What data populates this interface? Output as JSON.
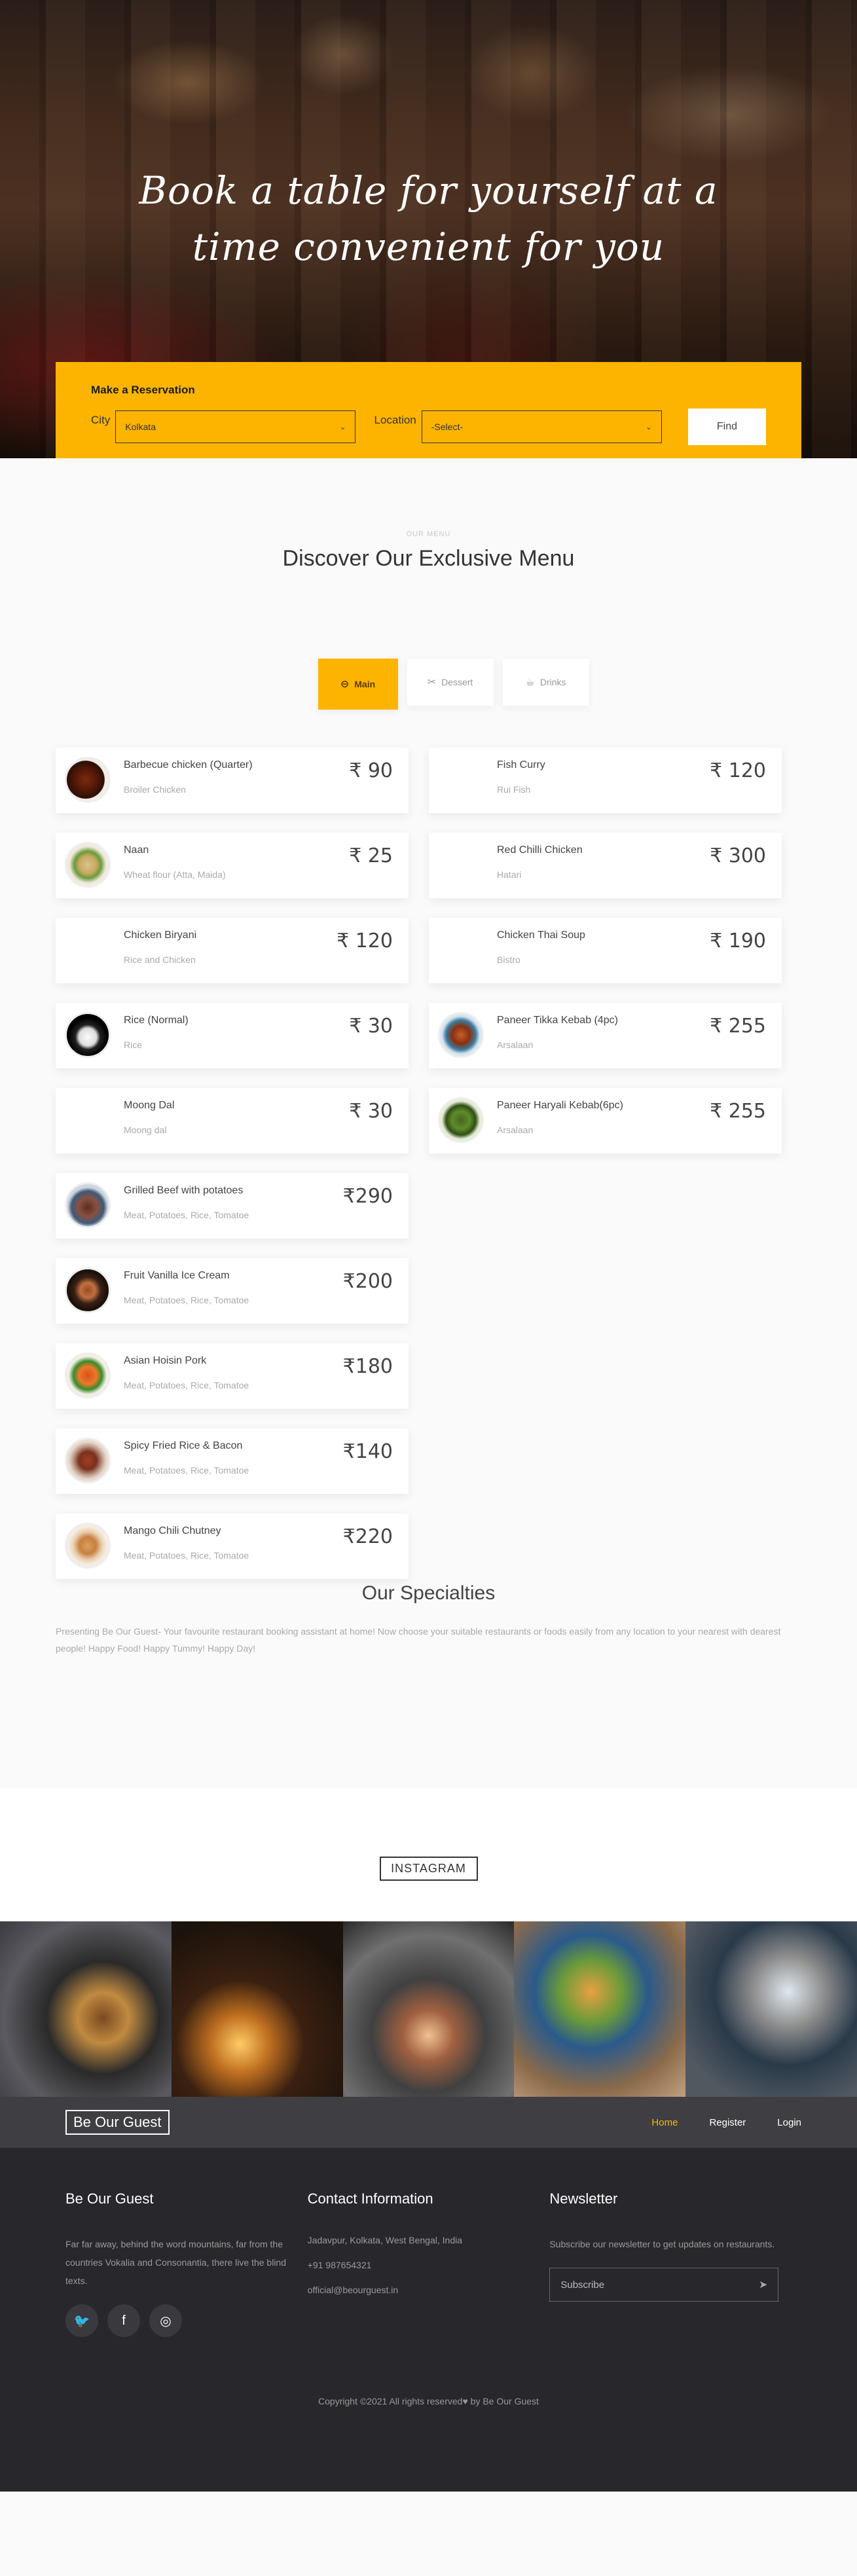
{
  "hero": {
    "title_line1": "Book a table for yourself at a",
    "title_line2": "time convenient for you"
  },
  "reservation": {
    "heading": "Make a Reservation",
    "city_label": "City",
    "city_value": "Kolkata",
    "location_label": "Location",
    "location_value": "-Select-",
    "find_label": "Find"
  },
  "menu": {
    "eyebrow": "OUR MENU",
    "title": "Discover Our Exclusive Menu",
    "tabs": [
      {
        "label": "Main",
        "icon": "dish-icon"
      },
      {
        "label": "Dessert",
        "icon": "utensils-icon"
      },
      {
        "label": "Drinks",
        "icon": "drink-icon"
      }
    ],
    "left_items": [
      {
        "name": "Barbecue chicken (Quarter)",
        "desc": "Broiler Chicken",
        "price": "₹ 90"
      },
      {
        "name": "Naan",
        "desc": "Wheat flour (Atta, Maida)",
        "price": "₹ 25"
      },
      {
        "name": "Chicken Biryani",
        "desc": "Rice and Chicken",
        "price": "₹ 120"
      },
      {
        "name": "Rice (Normal)",
        "desc": "Rice",
        "price": "₹ 30"
      },
      {
        "name": "Moong Dal",
        "desc": "Moong dal",
        "price": "₹ 30"
      },
      {
        "name": "Grilled Beef with potatoes",
        "desc": "Meat, Potatoes, Rice, Tomatoe",
        "price": "₹290"
      },
      {
        "name": "Fruit Vanilla Ice Cream",
        "desc": "Meat, Potatoes, Rice, Tomatoe",
        "price": "₹200"
      },
      {
        "name": "Asian Hoisin Pork",
        "desc": "Meat, Potatoes, Rice, Tomatoe",
        "price": "₹180"
      },
      {
        "name": "Spicy Fried Rice & Bacon",
        "desc": "Meat, Potatoes, Rice, Tomatoe",
        "price": "₹140"
      },
      {
        "name": "Mango Chili Chutney",
        "desc": "Meat, Potatoes, Rice, Tomatoe",
        "price": "₹220"
      }
    ],
    "right_items": [
      {
        "name": "Fish Curry",
        "desc": "Rui Fish",
        "price": "₹ 120"
      },
      {
        "name": "Red Chilli Chicken",
        "desc": "Hatari",
        "price": "₹ 300"
      },
      {
        "name": "Chicken Thai Soup",
        "desc": "Bistro",
        "price": "₹ 190"
      },
      {
        "name": "Paneer Tikka Kebab (4pc)",
        "desc": "Arsalaan",
        "price": "₹ 255"
      },
      {
        "name": "Paneer Haryali Kebab(6pc)",
        "desc": "Arsalaan",
        "price": "₹ 255"
      }
    ]
  },
  "specialties": {
    "title": "Our Specialties",
    "text": "Presenting Be Our Guest- Your favourite restaurant booking assistant at home! Now choose your suitable restaurants or foods easily from any location to your nearest with dearest people! Happy Food! Happy Tummy! Happy Day!"
  },
  "instagram": {
    "label": "INSTAGRAM"
  },
  "nav": {
    "brand": "Be Our Guest",
    "home": "Home",
    "register": "Register",
    "login": "Login"
  },
  "footer": {
    "about_title": "Be Our Guest",
    "about_text": "Far far away, behind the word mountains, far from the countries Vokalia and Consonantia, there live the blind texts.",
    "contact_title": "Contact Information",
    "address": "Jadavpur, Kolkata, West Bengal, India",
    "phone": "+91 987654321",
    "email": "official@beourguest.in",
    "newsletter_title": "Newsletter",
    "newsletter_text": "Subscribe our newsletter to get updates on restaurants.",
    "subscribe_placeholder": "Subscribe",
    "copyright_pre": "Copyright ©2021 All rights reserved",
    "copyright_post": " by Be Our Guest"
  },
  "colors": {
    "accent": "#fdb401",
    "footer_bg": "#28272c",
    "nav_bg": "#3f3f43"
  }
}
